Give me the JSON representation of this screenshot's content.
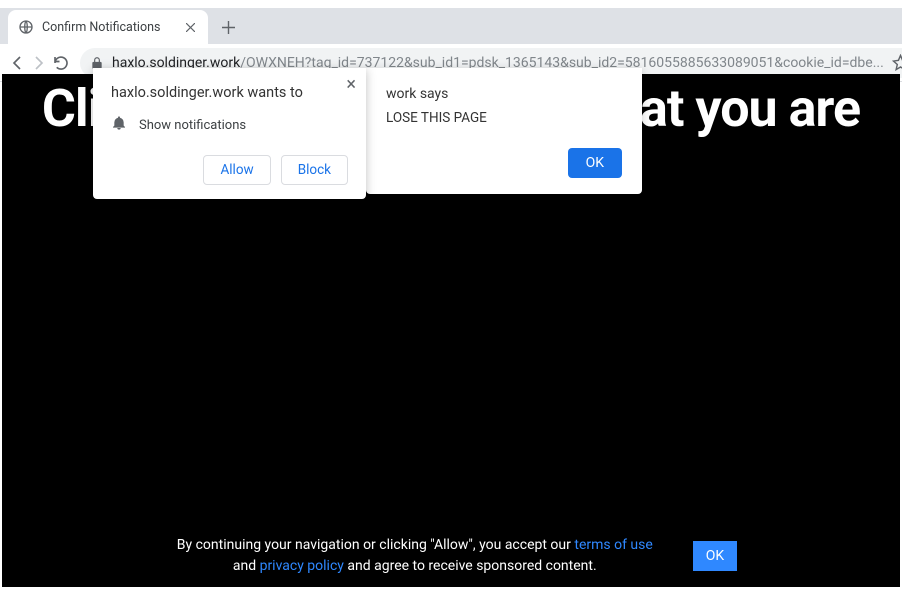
{
  "tab": {
    "title": "Confirm Notifications"
  },
  "url": {
    "domain": "haxlo.soldinger.work",
    "path": "/OWXNEH?tag_id=737122&sub_id1=pdsk_1365143&sub_id2=5816055885633089051&cookie_id=dbe..."
  },
  "page": {
    "headline": "Click «Allow» to confirm that you are"
  },
  "cookie": {
    "pre": "By continuing your navigation or clicking \"Allow\", you accept our ",
    "terms": "terms of use",
    "and": " and ",
    "privacy": "privacy policy",
    "post": " and agree to receive sponsored content.",
    "ok": "OK"
  },
  "alert": {
    "title": "work says",
    "body": "LOSE THIS PAGE",
    "ok": "OK"
  },
  "perm": {
    "title": "haxlo.soldinger.work wants to",
    "label": "Show notifications",
    "allow": "Allow",
    "block": "Block"
  }
}
